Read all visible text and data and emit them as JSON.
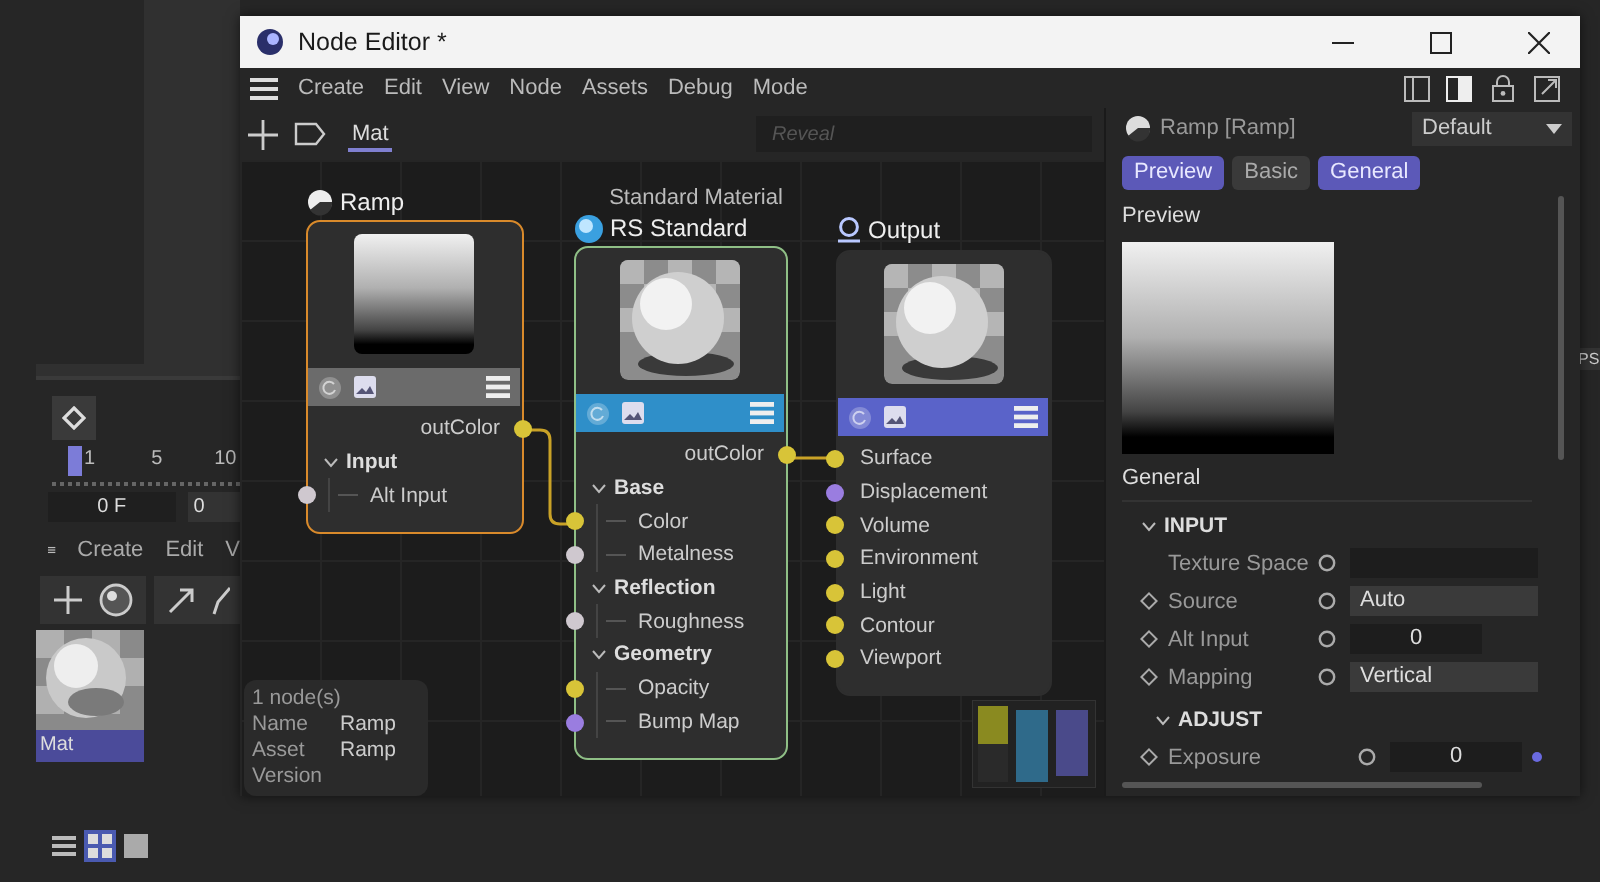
{
  "background_app": {
    "ruler_labels": [
      "1",
      "5",
      "10"
    ],
    "frame_fields": [
      "0 F",
      "0"
    ],
    "menu": [
      "Create",
      "Edit",
      "V"
    ],
    "material": {
      "name": "Mat",
      "selected": true
    },
    "view_modes": [
      {
        "kind": "list",
        "selected": false
      },
      {
        "kind": "grid",
        "selected": true
      },
      {
        "kind": "single",
        "selected": false
      }
    ],
    "edge_tab": "PS"
  },
  "window": {
    "title": "Node Editor *",
    "menu": [
      "Create",
      "Edit",
      "View",
      "Node",
      "Assets",
      "Debug",
      "Mode"
    ],
    "tab": "Mat",
    "search": {
      "placeholder": "Reveal"
    }
  },
  "nodes": [
    {
      "kind": "ramp",
      "title": "Ramp",
      "color": "#d98a2b",
      "ports": [
        {
          "kind": "output",
          "name": "outColor",
          "color": "#d8c438"
        },
        {
          "kind": "group",
          "name": "Input",
          "expanded": true,
          "children": [
            {
              "name": "Alt Input",
              "color": "#cfc8cf"
            }
          ]
        }
      ]
    },
    {
      "kind": "material",
      "subtitle": "Standard Material",
      "title": "RS Standard",
      "color": "#8fbf86",
      "ports": [
        {
          "kind": "output",
          "name": "outColor",
          "color": "#d8c438"
        },
        {
          "kind": "group",
          "name": "Base",
          "expanded": true,
          "children": [
            {
              "name": "Color",
              "color": "#d8c438"
            },
            {
              "name": "Metalness",
              "color": "#cfc8cf"
            }
          ]
        },
        {
          "kind": "group",
          "name": "Reflection",
          "expanded": true,
          "children": [
            {
              "name": "Roughness",
              "color": "#cfc8cf"
            }
          ]
        },
        {
          "kind": "group",
          "name": "Geometry",
          "expanded": true,
          "children": [
            {
              "name": "Opacity",
              "color": "#d8c438"
            },
            {
              "name": "Bump Map",
              "color": "#9a7de0"
            }
          ]
        }
      ]
    },
    {
      "kind": "output",
      "title": "Output",
      "ports": [
        {
          "kind": "input",
          "name": "Surface",
          "color": "#d8c438"
        },
        {
          "kind": "input",
          "name": "Displacement",
          "color": "#9a7de0"
        },
        {
          "kind": "input",
          "name": "Volume",
          "color": "#d8c438"
        },
        {
          "kind": "input",
          "name": "Environment",
          "color": "#d8c438"
        },
        {
          "kind": "input",
          "name": "Light",
          "color": "#d8c438"
        },
        {
          "kind": "input",
          "name": "Contour",
          "color": "#d8c438"
        },
        {
          "kind": "input",
          "name": "Viewport",
          "color": "#d8c438"
        }
      ]
    }
  ],
  "info": {
    "count": "1 node(s)",
    "fields": [
      {
        "label": "Name",
        "value": "Ramp"
      },
      {
        "label": "Asset",
        "value": "Ramp"
      },
      {
        "label": "Version"
      }
    ]
  },
  "properties": {
    "header": "Ramp [Ramp]",
    "preset": "Default",
    "tabs": [
      {
        "label": "Preview",
        "selected": true
      },
      {
        "label": "Basic",
        "selected": false
      },
      {
        "label": "General",
        "selected": true
      }
    ],
    "preview_label": "Preview",
    "section_label": "General",
    "groups": [
      {
        "title": "INPUT",
        "expanded": true,
        "rows": [
          {
            "label": "Texture Space",
            "keyframe": false,
            "kind": "field"
          },
          {
            "label": "Source",
            "keyframe": true,
            "kind": "dropdown",
            "value": "Auto"
          },
          {
            "label": "Alt Input",
            "keyframe": true,
            "kind": "number",
            "value": "0"
          },
          {
            "label": "Mapping",
            "keyframe": true,
            "kind": "dropdown",
            "value": "Vertical"
          }
        ],
        "children": [
          {
            "title": "ADJUST",
            "expanded": true,
            "rows": [
              {
                "label": "Exposure",
                "keyframe": true,
                "kind": "number",
                "value": "0",
                "modified": true
              }
            ]
          }
        ]
      }
    ]
  }
}
